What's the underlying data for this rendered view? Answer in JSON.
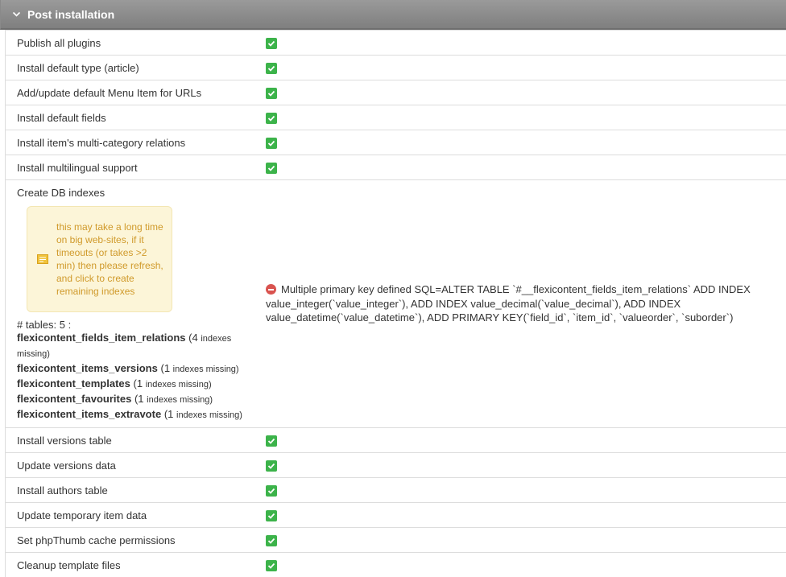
{
  "panel": {
    "title": "Post installation"
  },
  "rows_top": [
    {
      "label": "Publish all plugins"
    },
    {
      "label": "Install default type (article)"
    },
    {
      "label": "Add/update default Menu Item for URLs"
    },
    {
      "label": "Install default fields"
    },
    {
      "label": "Install item's multi-category relations"
    },
    {
      "label": "Install multilingual support"
    }
  ],
  "db": {
    "label": "Create DB indexes",
    "tip": "this may take a long time on big web-sites, if it timeouts (or takes >2 min) then please refresh, and click to create remaining indexes",
    "tables_count": "# tables: 5 :",
    "tables": [
      {
        "name": "flexicontent_fields_item_relations",
        "count": "(4",
        "suffix": "indexes missing)"
      },
      {
        "name": "flexicontent_items_versions",
        "count": "(1",
        "suffix": "indexes missing)"
      },
      {
        "name": "flexicontent_templates",
        "count": "(1",
        "suffix": "indexes missing)"
      },
      {
        "name": "flexicontent_favourites",
        "count": "(1",
        "suffix": "indexes missing)"
      },
      {
        "name": "flexicontent_items_extravote",
        "count": "(1",
        "suffix": "indexes missing)"
      }
    ],
    "error": "Multiple primary key defined SQL=ALTER TABLE `#__flexicontent_fields_item_relations` ADD INDEX value_integer(`value_integer`), ADD INDEX value_decimal(`value_decimal`), ADD INDEX value_datetime(`value_datetime`), ADD PRIMARY KEY(`field_id`, `item_id`, `valueorder`, `suborder`)"
  },
  "rows_bottom": [
    {
      "label": "Install versions table"
    },
    {
      "label": "Update versions data"
    },
    {
      "label": "Install authors table"
    },
    {
      "label": "Update temporary item data"
    },
    {
      "label": "Set phpThumb cache permissions"
    },
    {
      "label": "Cleanup template files"
    }
  ],
  "icons": {
    "collapse": "chevron-down-icon",
    "ok": "check-icon",
    "error": "error-icon",
    "tip": "note-icon"
  },
  "colors": {
    "header": "#8a8a8a",
    "ok": "#3cb34a",
    "error": "#d9534f",
    "tip_bg": "#fcf5d8",
    "tip_text": "#d09a2b"
  }
}
